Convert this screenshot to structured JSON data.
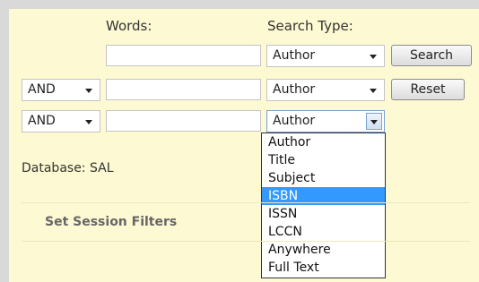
{
  "form": {
    "words_header": "Words:",
    "search_type_header": "Search Type:",
    "rows": [
      {
        "operator": "",
        "search_type": "Author"
      },
      {
        "operator": "AND",
        "search_type": "Author"
      },
      {
        "operator": "AND",
        "search_type": "Author"
      }
    ],
    "search_button": "Search",
    "reset_button": "Reset"
  },
  "dropdown": {
    "options": [
      "Author",
      "Title",
      "Subject",
      "ISBN",
      "ISSN",
      "LCCN",
      "Anywhere",
      "Full Text"
    ],
    "highlighted": "ISBN"
  },
  "database_label": "Database: SAL",
  "session_filters_label": "Set Session Filters",
  "colors": {
    "panel_bg": "#fdf9d2",
    "page_bg": "#d9d9d9",
    "highlight": "#3399ff",
    "filters_text": "#666666"
  }
}
